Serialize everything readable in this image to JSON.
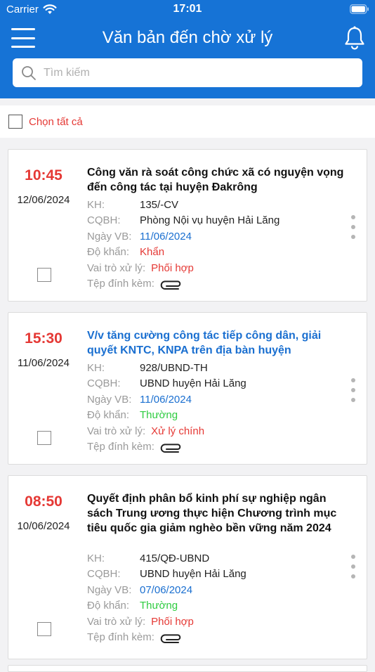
{
  "status_bar": {
    "carrier": "Carrier",
    "time": "17:01"
  },
  "nav": {
    "title": "Văn bản đến chờ xử lý"
  },
  "search": {
    "placeholder": "Tìm kiếm"
  },
  "select_all": {
    "label": "Chọn tất cả"
  },
  "field_labels": {
    "kh": "KH:",
    "cqbh": "CQBH:",
    "ngay_vb": "Ngày VB:",
    "do_khan": "Độ khẩn:",
    "vai_tro": "Vai trò xử lý:",
    "tep": "Tệp đính kèm:"
  },
  "documents": [
    {
      "time": "10:45",
      "date": "12/06/2024",
      "title": "Công văn rà soát công chức xã có nguyện vọng đến công tác tại huyện Đakrông",
      "kh": "135/-CV",
      "cqbh": "Phòng Nội vụ huyện Hải Lăng",
      "ngay_vb": "11/06/2024",
      "do_khan": "Khẩn",
      "vai_tro": "Phối hợp",
      "do_khan_color": "#e53935",
      "vai_tro_color": "#e53935",
      "title_color": "#111111"
    },
    {
      "time": "15:30",
      "date": "11/06/2024",
      "title": "V/v tăng cường công tác tiếp công dân, giải quyết KNTC, KNPA trên địa bàn huyện",
      "kh": "928/UBND-TH",
      "cqbh": "UBND huyện Hải Lăng",
      "ngay_vb": "11/06/2024",
      "do_khan": "Thường",
      "vai_tro": "Xử lý chính",
      "do_khan_color": "#2ecc40",
      "vai_tro_color": "#e53935",
      "title_color": "#1a6fd0"
    },
    {
      "time": "08:50",
      "date": "10/06/2024",
      "title": "Quyết định phân bổ kinh phí sự nghiệp ngân sách Trung ương thực hiện Chương trình mục tiêu quốc gia giảm nghèo bền vững năm 2024",
      "kh": "415/QĐ-UBND",
      "cqbh": "UBND huyện Hải Lăng",
      "ngay_vb": "07/06/2024",
      "do_khan": "Thường",
      "vai_tro": "Phối hợp",
      "do_khan_color": "#2ecc40",
      "vai_tro_color": "#e53935",
      "title_color": "#111111"
    }
  ],
  "colors": {
    "header": "#1673d6",
    "accent_red": "#e53935",
    "link_blue": "#1a6fd0",
    "normal_green": "#2ecc40"
  },
  "icons": [
    "wifi-icon",
    "battery-icon",
    "menu-icon",
    "bell-icon",
    "search-icon",
    "paperclip-icon",
    "more-vertical-icon"
  ]
}
